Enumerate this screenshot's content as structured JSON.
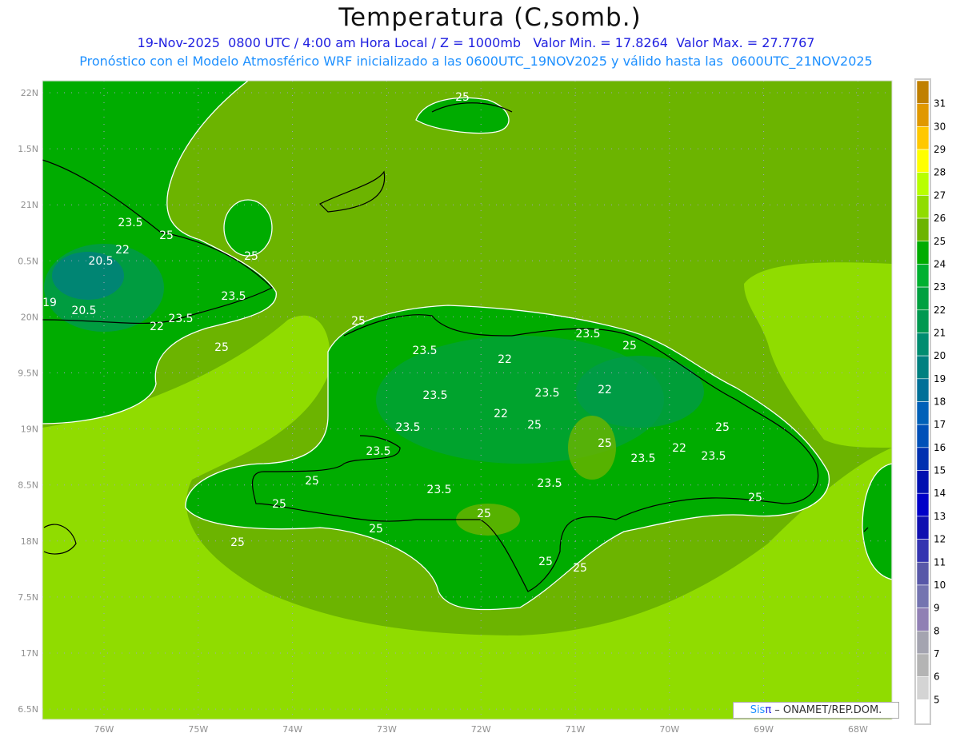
{
  "header": {
    "title": "Temperatura (C,somb.)",
    "subtitle1": "19-Nov-2025  0800 UTC / 4:00 am Hora Local / Z = 1000mb   Valor Min. = 17.8264  Valor Max. = 27.7767",
    "subtitle2": "Pronóstico con el Modelo Atmosférico WRF inicializado a las 0600UTC_19NOV2025 y válido hasta las  0600UTC_21NOV2025"
  },
  "axes": {
    "lon_labels": [
      "76W",
      "75W",
      "74W",
      "73W",
      "72W",
      "71W",
      "70W",
      "69W",
      "68W"
    ],
    "lat_labels": [
      "22N",
      "1.5N",
      "21N",
      "0.5N",
      "20N",
      "9.5N",
      "19N",
      "8.5N",
      "18N",
      "7.5N",
      "17N",
      "6.5N"
    ]
  },
  "colorbar": {
    "labels": [
      "31",
      "30",
      "29",
      "28",
      "27",
      "26",
      "25",
      "24",
      "23",
      "22",
      "21",
      "20",
      "19",
      "18",
      "17",
      "16",
      "15",
      "14",
      "13",
      "12",
      "11",
      "10",
      "9",
      "8",
      "7",
      "6",
      "5"
    ],
    "colors": [
      "#c08000",
      "#e09800",
      "#ffc800",
      "#ffff00",
      "#b8ff00",
      "#90dc00",
      "#6cb400",
      "#00ac00",
      "#00b030",
      "#00a040",
      "#009850",
      "#008c70",
      "#008080",
      "#007098",
      "#0060b8",
      "#0050b8",
      "#0030b0",
      "#0010b0",
      "#0000c8",
      "#1010b0",
      "#3434b0",
      "#5858a8",
      "#7474b0",
      "#9080b4",
      "#a4a4b0",
      "#b4b4b4",
      "#d4d4d4",
      "#ffffff"
    ]
  },
  "contour_labels": [
    "25",
    "25",
    "25",
    "25",
    "23.5",
    "22",
    "20.5",
    "19",
    "20.5",
    "23.5",
    "22",
    "23.5",
    "25",
    "23.5",
    "25",
    "23.5",
    "23.5",
    "22",
    "23.5",
    "22",
    "23.5",
    "22",
    "25",
    "22",
    "25",
    "23.5",
    "23.5",
    "25",
    "23.5",
    "23.5",
    "25",
    "25",
    "25",
    "25",
    "23.5",
    "25",
    "25",
    "25",
    "25"
  ],
  "credit": {
    "brand_a": "Sis",
    "brand_b": "π",
    "text": " – ONAMET/REP.DOM."
  },
  "colors": {
    "background_light": "#90dc00",
    "background_dark": "#6cb400",
    "land_green": "#00ac00",
    "title_blue": "#2020e0",
    "subtitle_blue": "#1e90ff"
  }
}
